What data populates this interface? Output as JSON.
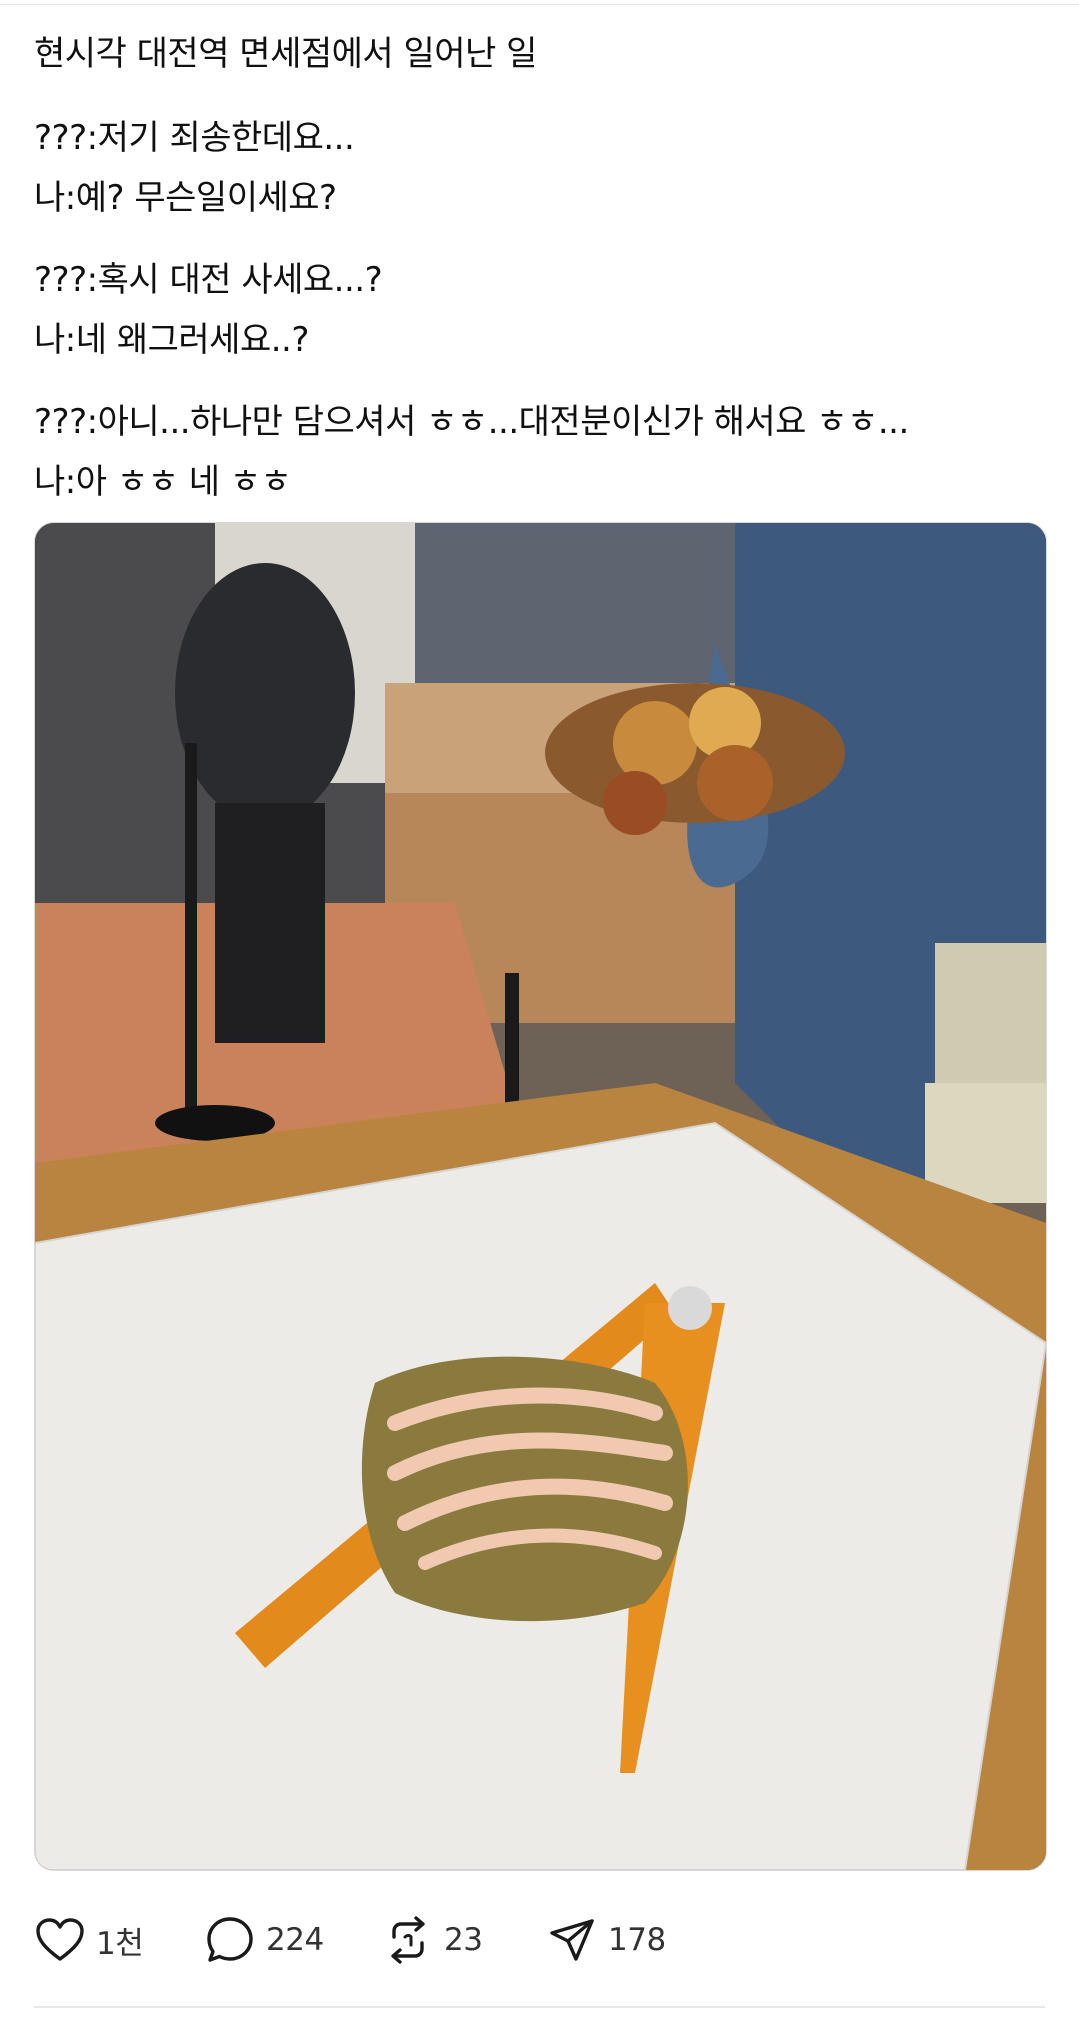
{
  "post": {
    "title_line": "현시각 대전역 면세점에서 일어난 일",
    "dialogue": [
      {
        "a": "???:저기 죄송한데요...",
        "b": "나:예? 무슨일이세요?"
      },
      {
        "a": "???:혹시 대전 사세요...?",
        "b": "나:네 왜그러세요..?"
      },
      {
        "a": "???:아니...하나만 담으셔서 ㅎㅎ...대전분이신가 해서요 ㅎㅎ...",
        "b": "나:아 ㅎㅎ 네 ㅎㅎ"
      }
    ]
  },
  "actions": {
    "like": {
      "icon": "heart-icon",
      "count": "1천"
    },
    "comment": {
      "icon": "comment-bubble-icon",
      "count": "224"
    },
    "repost": {
      "icon": "repost-icon",
      "count": "23"
    },
    "share": {
      "icon": "send-icon",
      "count": "178"
    }
  },
  "colors": {
    "text": "#101010",
    "icon": "#1a1a1a",
    "divider": "#e8e8e8"
  }
}
